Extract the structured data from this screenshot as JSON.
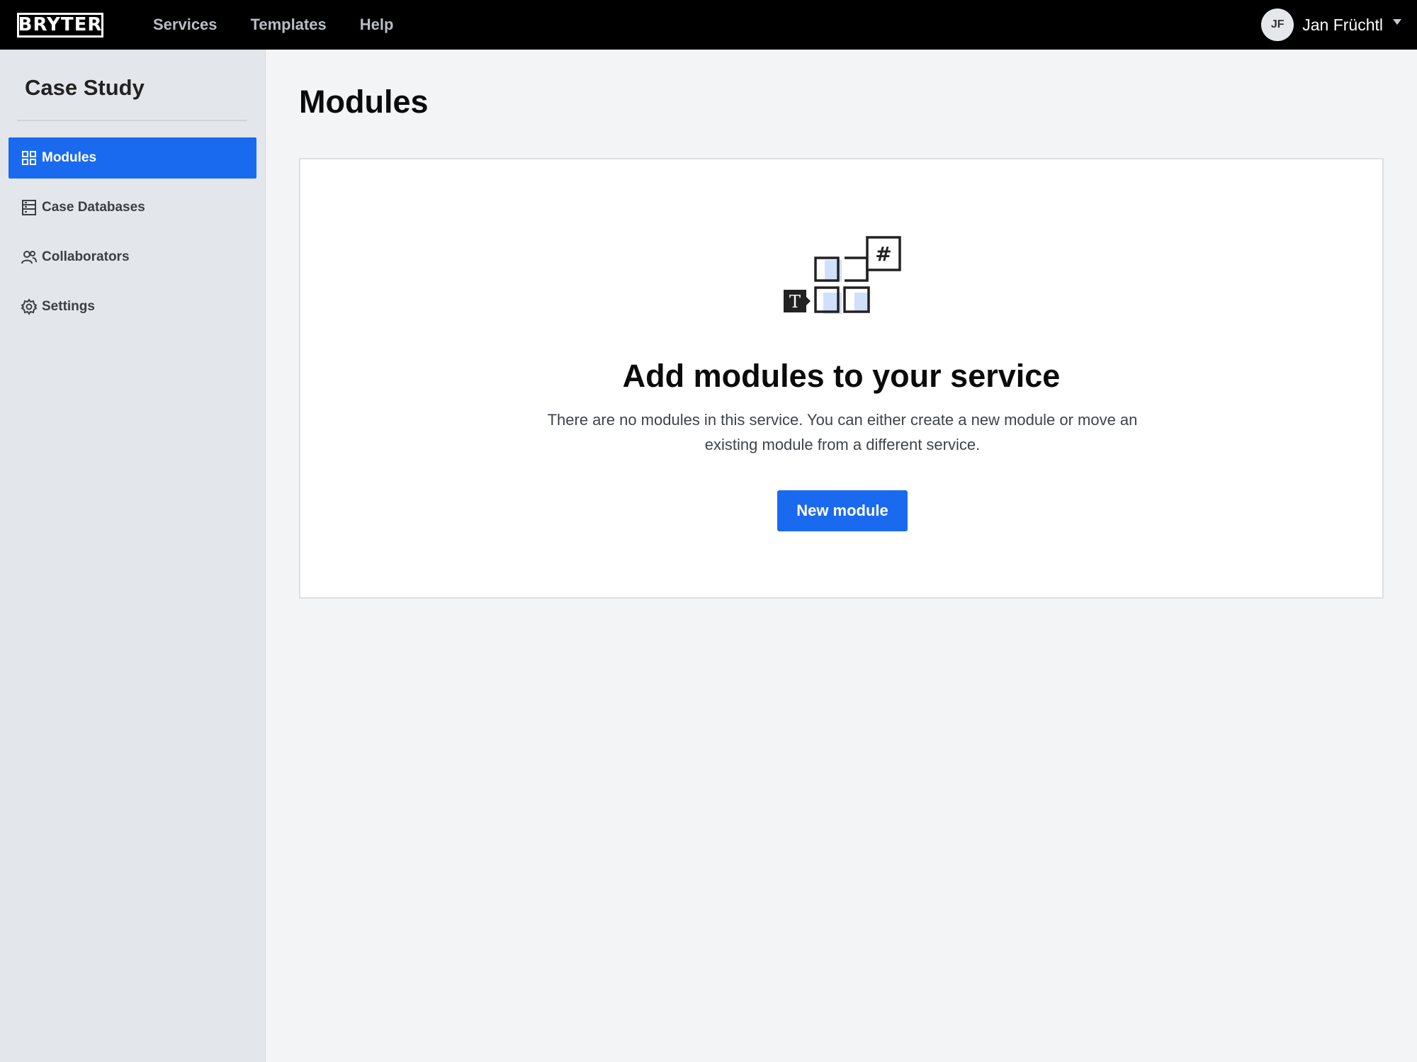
{
  "header": {
    "logo_text": "BRYTER",
    "nav": [
      {
        "label": "Services"
      },
      {
        "label": "Templates"
      },
      {
        "label": "Help"
      }
    ],
    "user": {
      "initials": "JF",
      "name": "Jan Früchtl"
    }
  },
  "sidebar": {
    "title": "Case Study",
    "items": [
      {
        "label": "Modules",
        "icon": "grid-icon",
        "active": true
      },
      {
        "label": "Case Databases",
        "icon": "database-icon",
        "active": false
      },
      {
        "label": "Collaborators",
        "icon": "users-icon",
        "active": false
      },
      {
        "label": "Settings",
        "icon": "gear-icon",
        "active": false
      }
    ]
  },
  "main": {
    "title": "Modules",
    "empty_state": {
      "illustration_icon": "modules-illustration-icon",
      "illustration_glyphs": {
        "text": "T",
        "number": "#"
      },
      "title": "Add modules to your service",
      "description": "There are no modules in this service. You can either create a new module or move an existing module from a different service.",
      "button_label": "New module"
    }
  },
  "colors": {
    "accent": "#1a6aef",
    "topbar": "#000000",
    "sidebar_bg": "#e3e6ea",
    "page_bg": "#f3f4f6",
    "illustration_fill": "#cfe0fb"
  }
}
